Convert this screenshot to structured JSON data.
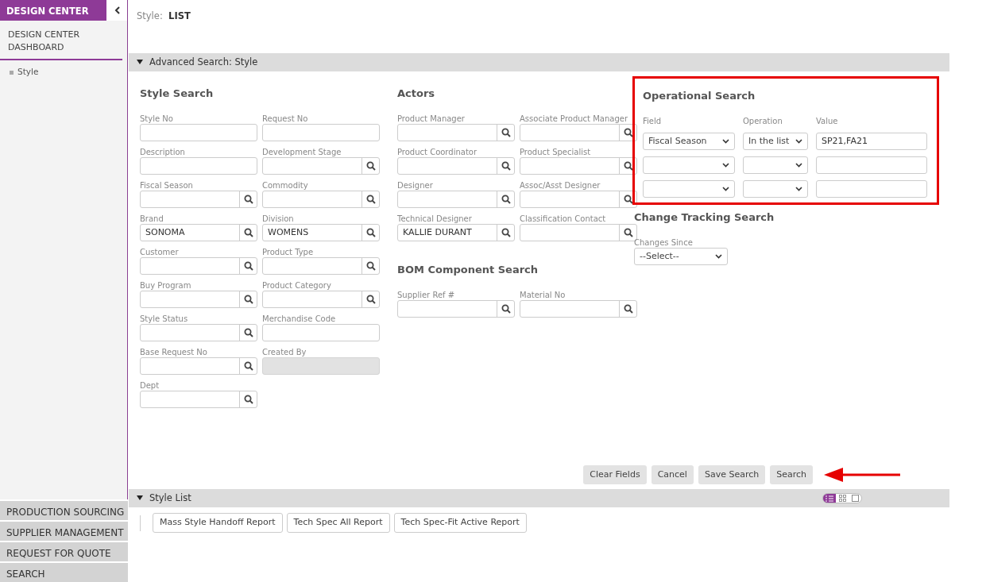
{
  "sidebar": {
    "title": "DESIGN CENTER",
    "items": [
      {
        "label": "DESIGN CENTER DASHBOARD"
      }
    ],
    "sub_items": [
      {
        "label": "Style"
      }
    ],
    "modules": [
      {
        "label": "PRODUCTION SOURCING"
      },
      {
        "label": "SUPPLIER MANAGEMENT"
      },
      {
        "label": "REQUEST FOR QUOTE"
      },
      {
        "label": "SEARCH"
      }
    ]
  },
  "page_header": {
    "label": "Style:",
    "value": "LIST"
  },
  "advanced_search": {
    "title": "Advanced Search: Style",
    "style_search": {
      "title": "Style Search",
      "fields": [
        {
          "label": "Style No",
          "lookup": false,
          "disabled": false
        },
        {
          "label": "Request No",
          "lookup": false,
          "disabled": false
        },
        {
          "label": "Description",
          "lookup": false,
          "disabled": false
        },
        {
          "label": "Development Stage",
          "lookup": true,
          "disabled": false
        },
        {
          "label": "Fiscal Season",
          "lookup": true,
          "disabled": false
        },
        {
          "label": "Commodity",
          "lookup": true,
          "disabled": false
        },
        {
          "label": "Brand",
          "value": "SONOMA",
          "lookup": true,
          "disabled": false
        },
        {
          "label": "Division",
          "value": "WOMENS",
          "lookup": true,
          "disabled": false
        },
        {
          "label": "Customer",
          "lookup": true,
          "disabled": false
        },
        {
          "label": "Product Type",
          "lookup": true,
          "disabled": false
        },
        {
          "label": "Buy Program",
          "lookup": true,
          "disabled": false
        },
        {
          "label": "Product Category",
          "lookup": true,
          "disabled": false
        },
        {
          "label": "Style Status",
          "lookup": true,
          "disabled": false
        },
        {
          "label": "Merchandise Code",
          "lookup": false,
          "disabled": false
        },
        {
          "label": "Base Request No",
          "lookup": true,
          "disabled": false
        },
        {
          "label": "Created By",
          "lookup": false,
          "disabled": true
        },
        {
          "label": "Dept",
          "lookup": true,
          "disabled": false
        }
      ]
    },
    "actors": {
      "title": "Actors",
      "fields": [
        {
          "label": "Product Manager",
          "lookup": true,
          "disabled": false
        },
        {
          "label": "Associate Product Manager",
          "lookup": true,
          "disabled": false
        },
        {
          "label": "Product Coordinator",
          "lookup": true,
          "disabled": false
        },
        {
          "label": "Product Specialist",
          "lookup": true,
          "disabled": false
        },
        {
          "label": "Designer",
          "lookup": true,
          "disabled": false
        },
        {
          "label": "Assoc/Asst Designer",
          "lookup": true,
          "disabled": false
        },
        {
          "label": "Technical Designer",
          "value": "KALLIE DURANT",
          "lookup": true,
          "disabled": false
        },
        {
          "label": "Classification Contact",
          "lookup": true,
          "disabled": false
        }
      ]
    },
    "bom_search": {
      "title": "BOM Component Search",
      "fields": [
        {
          "label": "Supplier Ref #",
          "lookup": true,
          "disabled": false
        },
        {
          "label": "Material No",
          "lookup": true,
          "disabled": false
        }
      ]
    },
    "operational_search": {
      "title": "Operational Search",
      "columns": [
        "Field",
        "Operation",
        "Value"
      ],
      "rows": [
        {
          "field": "Fiscal Season",
          "operation": "In the list",
          "value": "SP21,FA21"
        },
        {},
        {}
      ]
    },
    "change_tracking": {
      "title": "Change Tracking Search",
      "label": "Changes Since",
      "value": "--Select--"
    },
    "buttons": [
      "Clear Fields",
      "Cancel",
      "Save Search",
      "Search"
    ]
  },
  "style_list": {
    "title": "Style List",
    "views": [
      {
        "kind": "list",
        "selected": true
      },
      {
        "kind": "grid",
        "selected": false
      },
      {
        "kind": "single",
        "selected": false
      }
    ],
    "reports": [
      "Mass Style Handoff Report",
      "Tech Spec All Report",
      "Tech Spec-Fit Active Report"
    ]
  }
}
